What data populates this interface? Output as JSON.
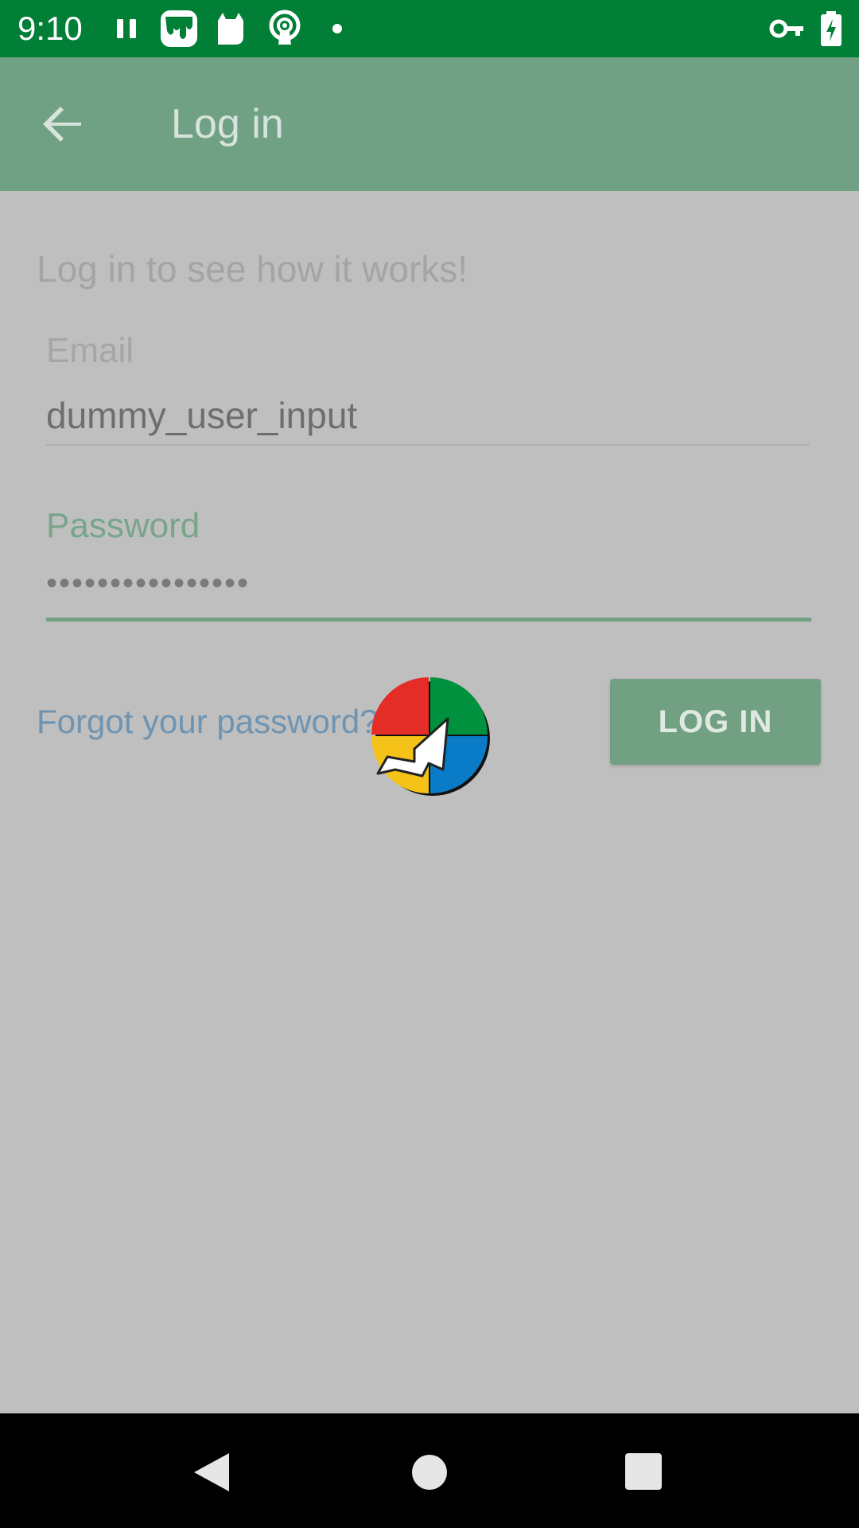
{
  "status_bar": {
    "time": "9:10",
    "icons": [
      "pause-icon",
      "app-drip-icon",
      "cat-icon",
      "podcast-icon",
      "dot-icon",
      "vpn-key-icon",
      "battery-charging-icon"
    ],
    "background": "#017f36"
  },
  "app_bar": {
    "title": "Log in",
    "back_icon": "arrow-back-icon",
    "background": "#71a184"
  },
  "content": {
    "intro": "Log in to see how it works!",
    "email": {
      "label": "Email",
      "value": "dummy_user_input"
    },
    "password": {
      "label": "Password",
      "value": "••••••••••••••••"
    },
    "forgot_link": "Forgot your password?",
    "login_button": "LOG IN",
    "accent": "#72a083",
    "link_color": "#6e94b3"
  },
  "overlay": {
    "icon": "pie-chart-arrow-logo-icon"
  },
  "nav_bar": {
    "icons": [
      "nav-back-icon",
      "nav-home-icon",
      "nav-recents-icon"
    ]
  }
}
